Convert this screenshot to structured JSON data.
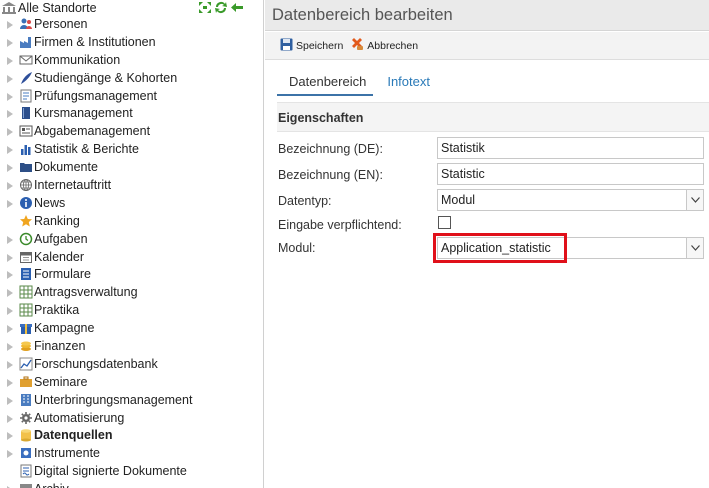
{
  "tree": {
    "root_label": "Alle Standorte",
    "items": [
      {
        "label": "Personen",
        "icon": "people-icon",
        "expander": true,
        "bold": false
      },
      {
        "label": "Firmen & Institutionen",
        "icon": "factory-icon",
        "expander": true,
        "bold": false
      },
      {
        "label": "Kommunikation",
        "icon": "envelope-icon",
        "expander": true,
        "bold": false
      },
      {
        "label": "Studiengänge & Kohorten",
        "icon": "feather-icon",
        "expander": true,
        "bold": false
      },
      {
        "label": "Prüfungsmanagement",
        "icon": "exam-icon",
        "expander": true,
        "bold": false
      },
      {
        "label": "Kursmanagement",
        "icon": "book-icon",
        "expander": true,
        "bold": false
      },
      {
        "label": "Abgabemanagement",
        "icon": "submission-icon",
        "expander": true,
        "bold": false
      },
      {
        "label": "Statistik & Berichte",
        "icon": "bar-chart-icon",
        "expander": true,
        "bold": false
      },
      {
        "label": "Dokumente",
        "icon": "folder-icon",
        "expander": true,
        "bold": false
      },
      {
        "label": "Internetauftritt",
        "icon": "globe-icon",
        "expander": true,
        "bold": false
      },
      {
        "label": "News",
        "icon": "info-icon",
        "expander": true,
        "bold": false
      },
      {
        "label": "Ranking",
        "icon": "star-icon",
        "expander": false,
        "bold": false
      },
      {
        "label": "Aufgaben",
        "icon": "clock-arrow-icon",
        "expander": true,
        "bold": false
      },
      {
        "label": "Kalender",
        "icon": "calendar-icon",
        "expander": true,
        "bold": false
      },
      {
        "label": "Formulare",
        "icon": "form-icon",
        "expander": true,
        "bold": false
      },
      {
        "label": "Antragsverwaltung",
        "icon": "grid-icon",
        "expander": true,
        "bold": false
      },
      {
        "label": "Praktika",
        "icon": "grid-icon",
        "expander": true,
        "bold": false
      },
      {
        "label": "Kampagne",
        "icon": "gift-icon",
        "expander": true,
        "bold": false
      },
      {
        "label": "Finanzen",
        "icon": "coins-icon",
        "expander": true,
        "bold": false
      },
      {
        "label": "Forschungsdatenbank",
        "icon": "line-chart-icon",
        "expander": true,
        "bold": false
      },
      {
        "label": "Seminare",
        "icon": "briefcase-icon",
        "expander": true,
        "bold": false
      },
      {
        "label": "Unterbringungsmanagement",
        "icon": "building-icon",
        "expander": true,
        "bold": false
      },
      {
        "label": "Automatisierung",
        "icon": "gear-icon",
        "expander": true,
        "bold": false
      },
      {
        "label": "Datenquellen",
        "icon": "database-icon",
        "expander": true,
        "bold": true
      },
      {
        "label": "Instrumente",
        "icon": "instrument-icon",
        "expander": true,
        "bold": false
      },
      {
        "label": "Digital signierte Dokumente",
        "icon": "signed-doc-icon",
        "expander": false,
        "bold": false
      },
      {
        "label": "Archiv",
        "icon": "archive-icon",
        "expander": true,
        "bold": false
      }
    ]
  },
  "panel": {
    "title": "Datenbereich bearbeiten",
    "toolbar": {
      "save_label": "Speichern",
      "cancel_label": "Abbrechen"
    },
    "tabs": [
      {
        "label": "Datenbereich",
        "active": true
      },
      {
        "label": "Infotext",
        "active": false
      }
    ],
    "section_title": "Eigenschaften",
    "form": {
      "name_de_label": "Bezeichnung (DE):",
      "name_de_value": "Statistik",
      "name_en_label": "Bezeichnung (EN):",
      "name_en_value": "Statistic",
      "datatype_label": "Datentyp:",
      "datatype_value": "Modul",
      "required_label": "Eingabe verpflichtend:",
      "required_checked": false,
      "module_label": "Modul:",
      "module_value": "Application_statistic"
    }
  },
  "colors": {
    "accent": "#3c73a8",
    "highlight": "#e0101a",
    "tab_link": "#2a7ab8"
  }
}
